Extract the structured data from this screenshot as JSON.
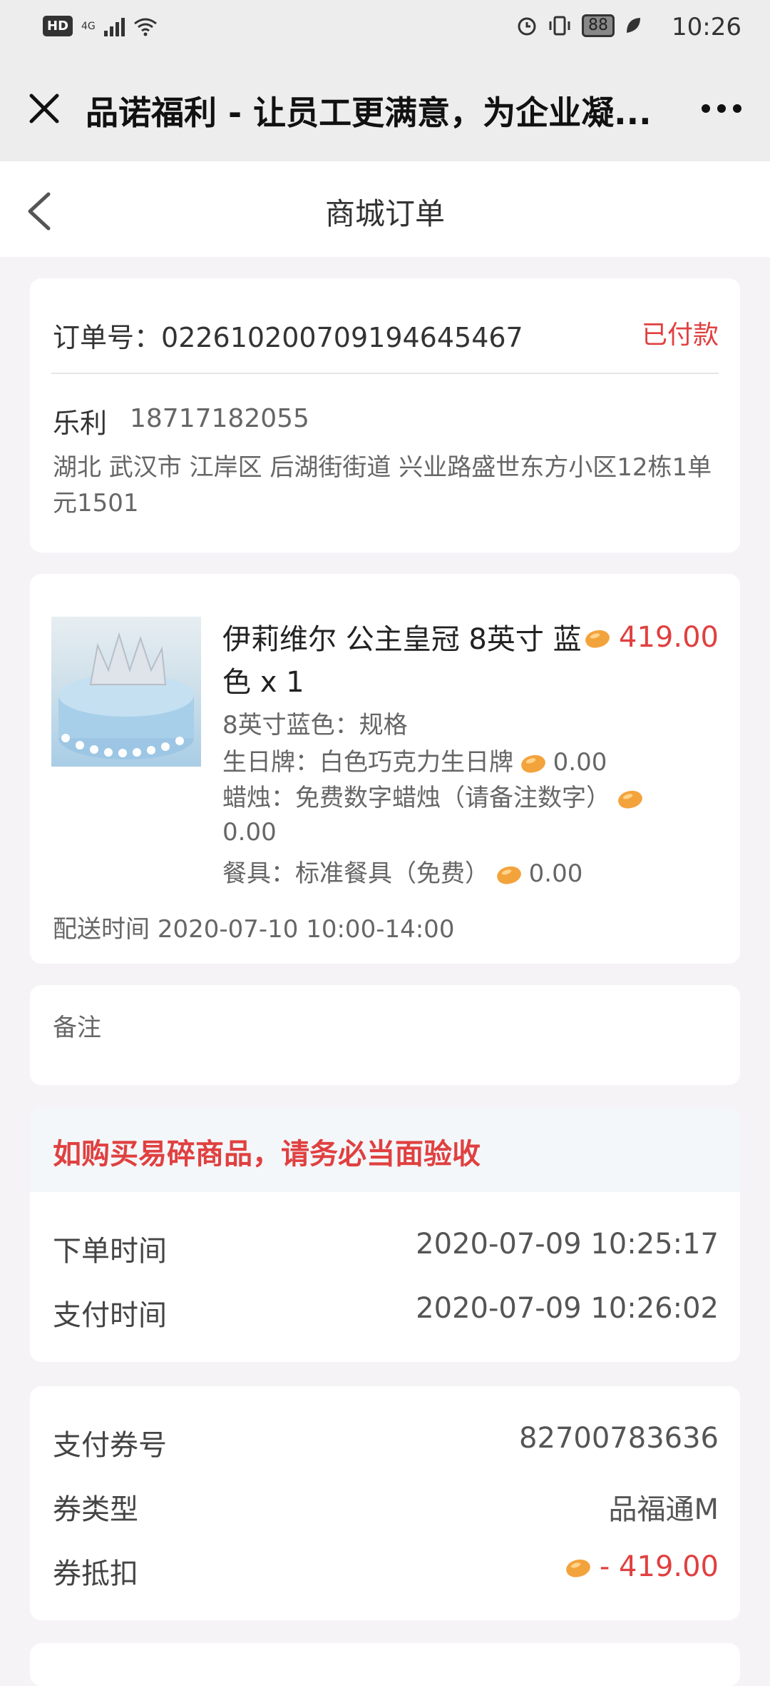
{
  "status_bar": {
    "left_badge": "HD",
    "network": "4G",
    "battery": "88",
    "time": "10:26"
  },
  "topbar": {
    "title": "品诺福利 - 让员工更满意，为企业凝..."
  },
  "header": {
    "title": "商城订单"
  },
  "order": {
    "number_label": "订单号：",
    "number": "02261020070919464 5467",
    "status": "已付款",
    "recipient_name": "乐利",
    "recipient_phone": "18717182055",
    "address": "湖北 武汉市 江岸区 后湖街街道 兴业路盛世东方小区12栋1单元1501"
  },
  "product": {
    "name": "伊莉维尔 公主皇冠 8英寸 蓝色 x 1",
    "price": "419.00",
    "spec": "8英寸蓝色：规格",
    "options": [
      {
        "label": "生日牌：白色巧克力生日牌",
        "price": "0.00"
      },
      {
        "label": "蜡烛：免费数字蜡烛（请备注数字）",
        "price": "0.00"
      },
      {
        "label": "餐具：标准餐具（免费）",
        "price": "0.00"
      }
    ],
    "delivery_label": "配送时间",
    "delivery_time": "2020-07-10 10:00-14:00"
  },
  "remark": {
    "label": "备注"
  },
  "notice": {
    "text": "如购买易碎商品，请务必当面验收"
  },
  "times": [
    {
      "label": "下单时间",
      "value": "2020-07-09 10:25:17"
    },
    {
      "label": "支付时间",
      "value": "2020-07-09 10:26:02"
    }
  ],
  "payment": {
    "voucher_no_label": "支付券号",
    "voucher_no": "82700783636",
    "type_label": "券类型",
    "type": "品福通M",
    "deduct_label": "券抵扣",
    "deduct": "- 419.00"
  },
  "colors": {
    "accent_red": "#e04040",
    "bean": "#f3a33c"
  }
}
